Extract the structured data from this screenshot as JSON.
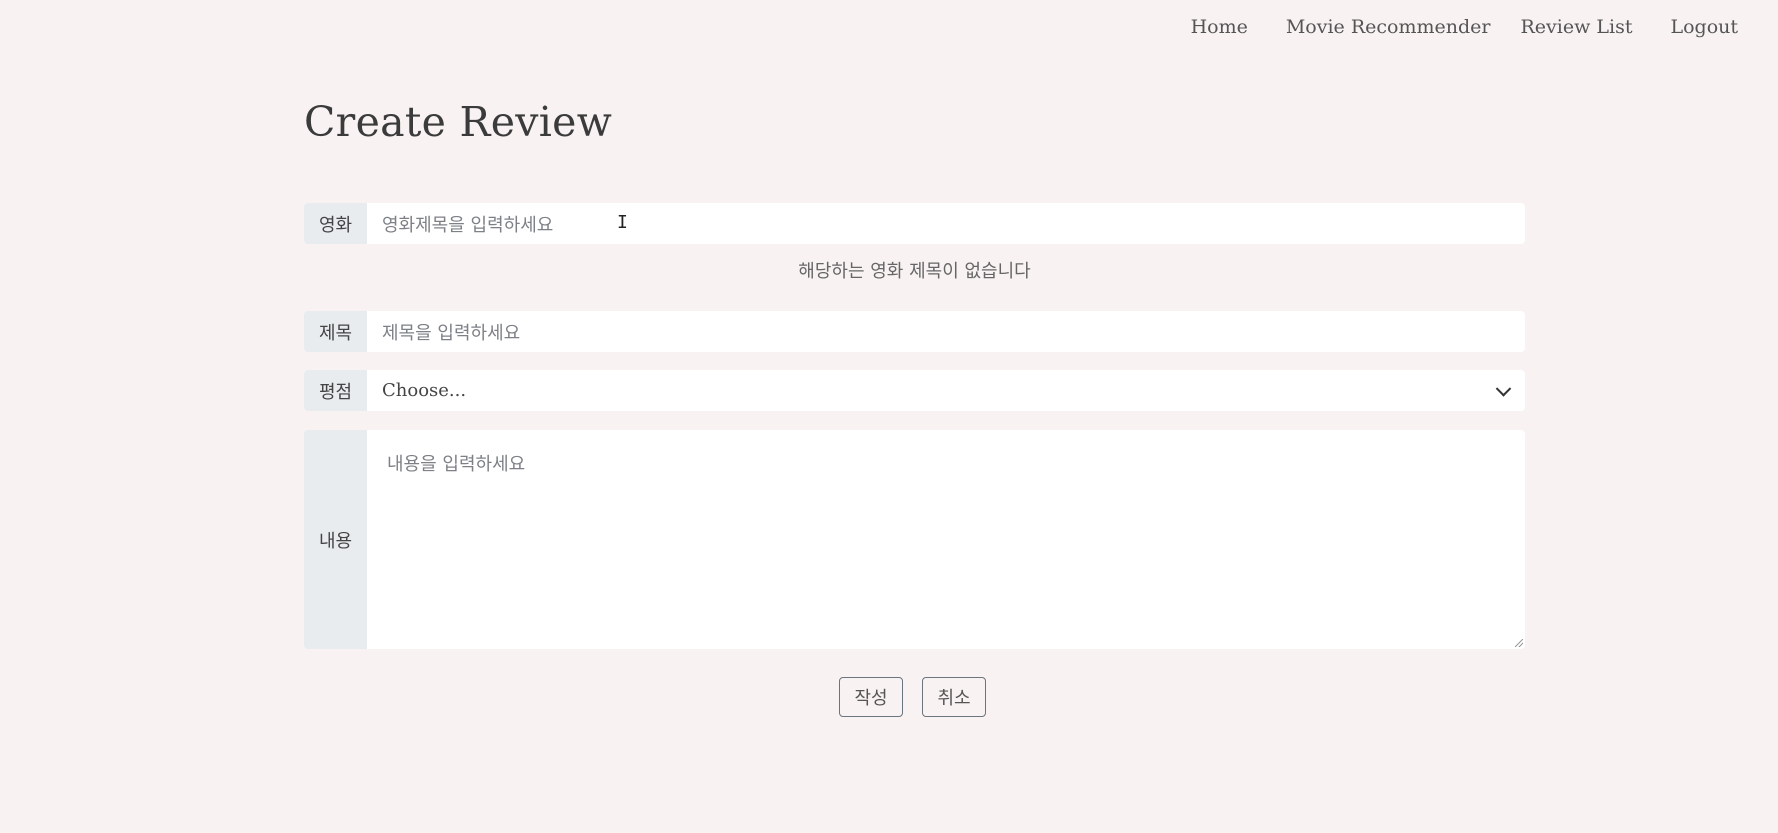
{
  "nav": {
    "home": "Home",
    "recommender": "Movie Recommender",
    "review_list": "Review List",
    "logout": "Logout"
  },
  "page": {
    "title": "Create Review"
  },
  "form": {
    "movie": {
      "label": "영화",
      "placeholder": "영화제목을 입력하세요",
      "hint": "해당하는 영화 제목이 없습니다"
    },
    "title": {
      "label": "제목",
      "placeholder": "제목을 입력하세요"
    },
    "rating": {
      "label": "평점",
      "selected": "Choose..."
    },
    "content": {
      "label": "내용",
      "placeholder": "내용을 입력하세요"
    },
    "submit_label": "작성",
    "cancel_label": "취소"
  },
  "colors": {
    "background": "#f8f2f2",
    "label_bg": "#e9ecef",
    "button_border": "#6c757d"
  },
  "icons": {
    "rating_dropdown": "chevron-down-icon",
    "text_cursor": "text-cursor-icon",
    "resize": "resize-handle-icon"
  }
}
